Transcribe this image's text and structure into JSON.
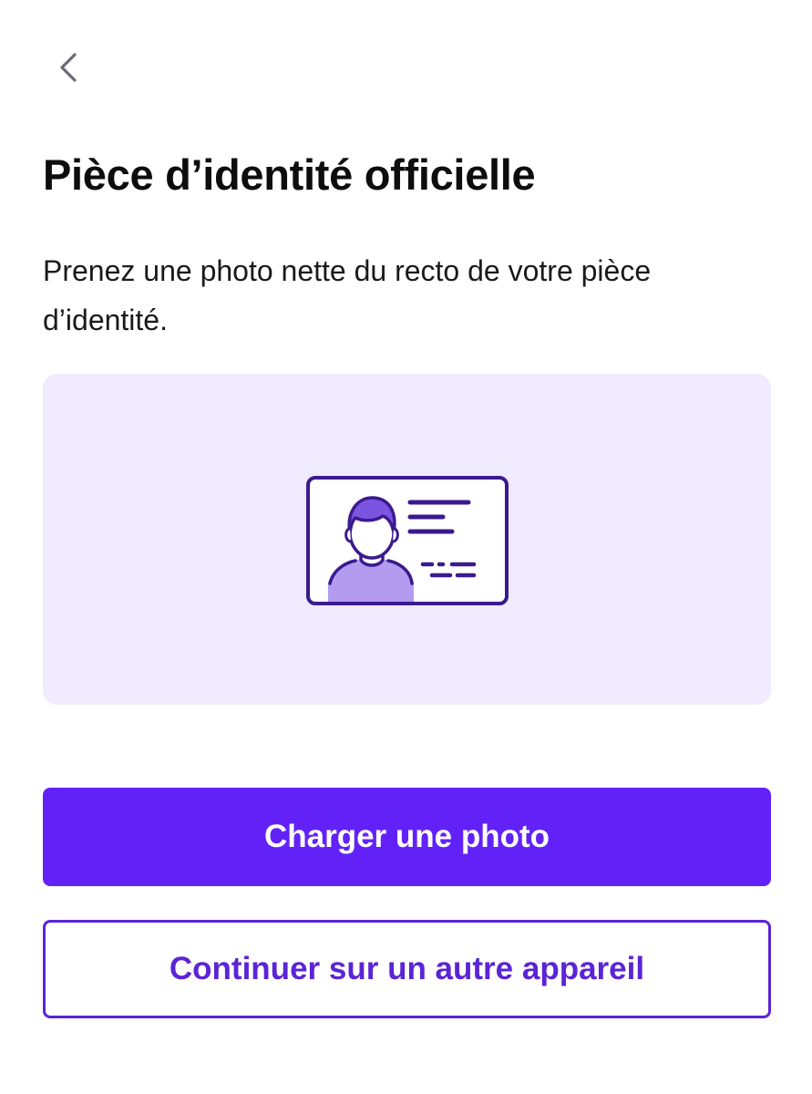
{
  "header": {
    "back_icon": "chevron-left-icon"
  },
  "page": {
    "title": "Pièce d’identité officielle",
    "subtitle": "Prenez une photo nette du recto de votre pièce d’identité."
  },
  "illustration": {
    "icon": "id-card-icon",
    "panel_color": "#efeafd",
    "accent_color": "#3b1a8f"
  },
  "actions": {
    "primary_label": "Charger une photo",
    "primary_color": "#6222f7",
    "secondary_label": "Continuer sur un autre appareil",
    "secondary_color": "#5b24d6"
  }
}
